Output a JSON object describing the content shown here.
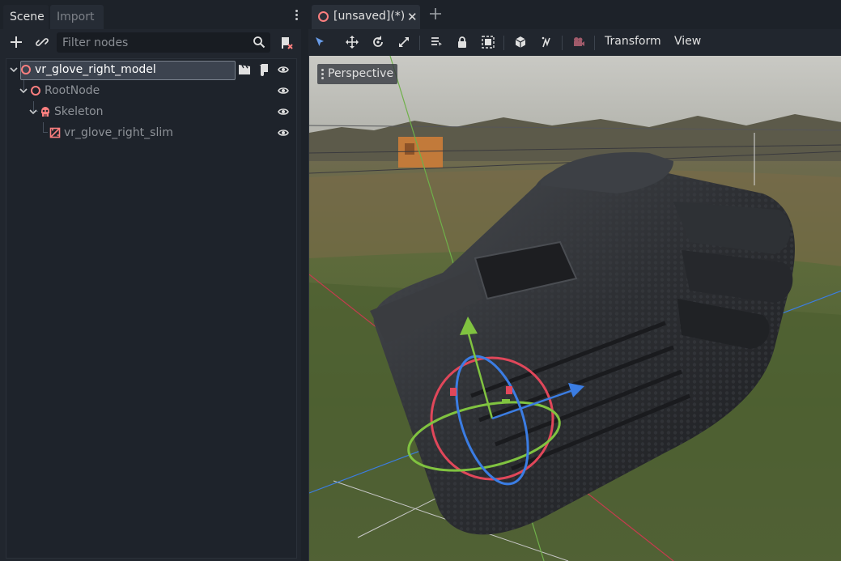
{
  "left_dock": {
    "tabs": [
      {
        "label": "Scene",
        "active": true
      },
      {
        "label": "Import",
        "active": false
      }
    ]
  },
  "scene_toolbar": {
    "filter_placeholder": "Filter nodes",
    "filter_value": ""
  },
  "scene_tree": {
    "nodes": [
      {
        "label": "vr_glove_right_model",
        "icon": "node3d-icon",
        "selected": true
      },
      {
        "label": "RootNode",
        "icon": "node3d-icon"
      },
      {
        "label": "Skeleton",
        "icon": "skeleton-icon"
      },
      {
        "label": "vr_glove_right_slim",
        "icon": "mesh-instance-icon"
      }
    ]
  },
  "editor": {
    "scene_tab_label": "[unsaved](*)",
    "menus": {
      "transform": "Transform",
      "view": "View"
    },
    "viewport_label": "Perspective"
  },
  "colors": {
    "accent": "#699ce8",
    "node_icon": "#fc7f7f",
    "panel_bg": "#21262e",
    "gizmo_x": "#e0475a",
    "gizmo_y": "#80c340",
    "gizmo_z": "#3b7de3"
  }
}
